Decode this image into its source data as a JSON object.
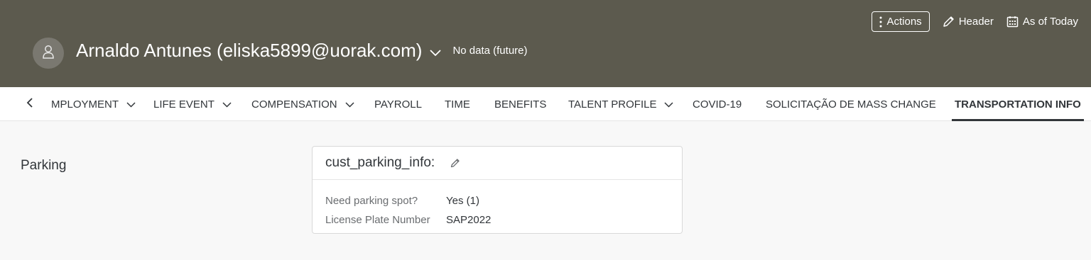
{
  "header": {
    "actions_label": "Actions",
    "header_label": "Header",
    "as_of_label": "As of Today",
    "person_name": "Arnaldo Antunes (eliska5899@uorak.com)",
    "status_text": "No data (future)",
    "background_color": "#5c5a4e"
  },
  "tabs": [
    {
      "label": "MPLOYMENT",
      "has_dropdown": true
    },
    {
      "label": "LIFE EVENT",
      "has_dropdown": true
    },
    {
      "label": "COMPENSATION",
      "has_dropdown": true
    },
    {
      "label": "PAYROLL",
      "has_dropdown": false
    },
    {
      "label": "TIME",
      "has_dropdown": false
    },
    {
      "label": "BENEFITS",
      "has_dropdown": false
    },
    {
      "label": "TALENT PROFILE",
      "has_dropdown": true
    },
    {
      "label": "COVID-19",
      "has_dropdown": false
    },
    {
      "label": "SOLICITAÇÃO DE MASS CHANGE",
      "has_dropdown": false
    },
    {
      "label": "TRANSPORTATION INFO",
      "has_dropdown": false,
      "active": true
    }
  ],
  "section": {
    "title": "Parking"
  },
  "card": {
    "title": "cust_parking_info:",
    "fields": [
      {
        "label": "Need parking spot?",
        "value": "Yes (1)"
      },
      {
        "label": "License Plate Number",
        "value": "SAP2022"
      }
    ]
  }
}
